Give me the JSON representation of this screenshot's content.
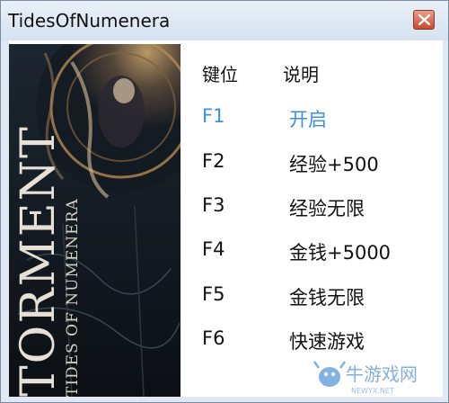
{
  "window": {
    "title": "TidesOfNumenera"
  },
  "cover": {
    "title_main": "TORMENT",
    "title_sub": "TIDES OF NUMENERA"
  },
  "table": {
    "header_key": "键位",
    "header_desc": "说明",
    "rows": [
      {
        "key": "F1",
        "desc": "开启",
        "active": true
      },
      {
        "key": "F2",
        "desc": "经验+500"
      },
      {
        "key": "F3",
        "desc": "经验无限"
      },
      {
        "key": "F4",
        "desc": "金钱+5000"
      },
      {
        "key": "F5",
        "desc": "金钱无限"
      },
      {
        "key": "F6",
        "desc": "快速游戏"
      }
    ]
  },
  "watermark": {
    "text": "牛游戏网",
    "sub": "NEWYX.NET"
  },
  "colors": {
    "active": "#3a8fe6",
    "text": "#111111",
    "frame": "#dfe8f3"
  }
}
